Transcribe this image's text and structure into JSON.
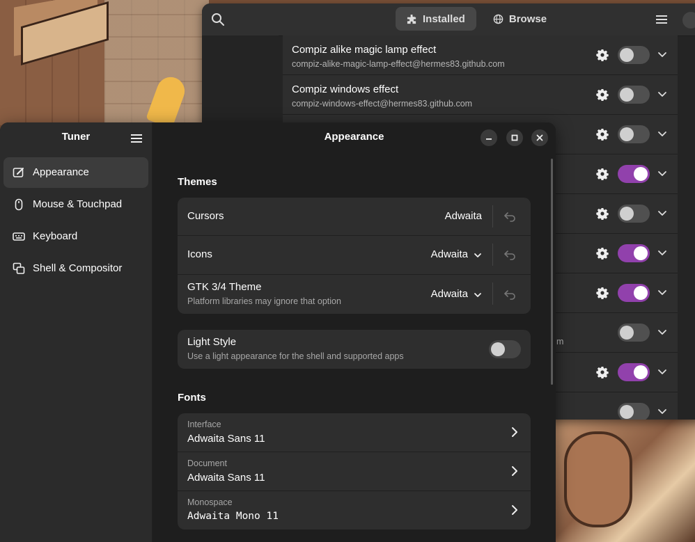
{
  "colors": {
    "accent": "#9141ac",
    "window_bg": "#1e1e1e",
    "sidebar_bg": "#2b2b2b",
    "card_bg": "#2e2e2e"
  },
  "extensions": {
    "tabs": [
      {
        "label": "Installed",
        "icon": "puzzle-icon",
        "active": true
      },
      {
        "label": "Browse",
        "icon": "globe-icon",
        "active": false
      }
    ],
    "rows": [
      {
        "title": "Compiz alike magic lamp effect",
        "subtitle": "compiz-alike-magic-lamp-effect@hermes83.github.com",
        "settings": true,
        "enabled": false
      },
      {
        "title": "Compiz windows effect",
        "subtitle": "compiz-windows-effect@hermes83.github.com",
        "settings": true,
        "enabled": false
      },
      {
        "title": "",
        "subtitle": "",
        "settings": true,
        "enabled": false
      },
      {
        "title": "",
        "subtitle": "",
        "settings": true,
        "enabled": true
      },
      {
        "title": "",
        "subtitle": "",
        "settings": true,
        "enabled": false
      },
      {
        "title": "",
        "subtitle": "",
        "settings": true,
        "enabled": true
      },
      {
        "title": "",
        "subtitle": "",
        "settings": true,
        "enabled": true
      },
      {
        "title": "",
        "subtitle": "m",
        "settings": false,
        "enabled": false
      },
      {
        "title": "",
        "subtitle": "",
        "settings": true,
        "enabled": true
      },
      {
        "title": "",
        "subtitle": "",
        "settings": false,
        "enabled": false
      }
    ]
  },
  "tuner": {
    "app_title": "Tuner",
    "page_title": "Appearance",
    "nav": [
      {
        "label": "Appearance",
        "icon": "appearance-icon",
        "active": true
      },
      {
        "label": "Mouse & Touchpad",
        "icon": "mouse-icon",
        "active": false
      },
      {
        "label": "Keyboard",
        "icon": "keyboard-icon",
        "active": false
      },
      {
        "label": "Shell & Compositor",
        "icon": "windows-icon",
        "active": false
      }
    ],
    "themes": {
      "heading": "Themes",
      "cursors": {
        "label": "Cursors",
        "value": "Adwaita"
      },
      "icons": {
        "label": "Icons",
        "value": "Adwaita"
      },
      "gtk": {
        "label": "GTK 3/4 Theme",
        "subtitle": "Platform libraries may ignore that option",
        "value": "Adwaita"
      }
    },
    "light_style": {
      "label": "Light Style",
      "subtitle": "Use a light appearance for the shell and supported apps",
      "enabled": false
    },
    "fonts": {
      "heading": "Fonts",
      "interface": {
        "label": "Interface",
        "value": "Adwaita Sans 11"
      },
      "document": {
        "label": "Document",
        "value": "Adwaita Sans 11"
      },
      "monospace": {
        "label": "Monospace",
        "value": "Adwaita Mono 11"
      }
    }
  }
}
